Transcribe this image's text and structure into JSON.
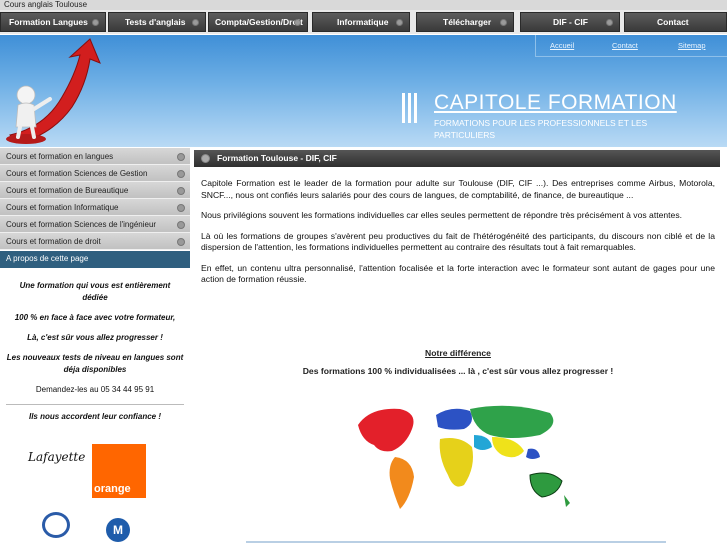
{
  "topbar": {
    "text": "Cours anglais Toulouse"
  },
  "nav": [
    {
      "label": "Formation Langues"
    },
    {
      "label": "Tests d'anglais"
    },
    {
      "label": "Compta/Gestion/Droit"
    },
    {
      "label": "Informatique"
    },
    {
      "label": "Télécharger"
    },
    {
      "label": "DIF - CIF"
    },
    {
      "label": "Contact"
    }
  ],
  "header": {
    "links": [
      "Accueil",
      "Contact",
      "Sitemap"
    ],
    "title": "CAPITOLE FORMATION",
    "subtitle": "FORMATIONS POUR LES PROFESSIONNELS ET LES PARTICULIERS"
  },
  "sidebar": {
    "items": [
      "Cours et formation en langues",
      "Cours et formation Sciences de Gestion",
      "Cours et formation de Bureautique",
      "Cours et formation Informatique",
      "Cours et formation Sciences de l'ingénieur",
      "Cours et formation de droit"
    ],
    "apropos": "A propos de cette page",
    "promo": {
      "line1": "Une formation qui vous est entièrement dédiée",
      "line2": "100 % en face à face avec votre formateur,",
      "line3": "Là, c'est sûr vous allez progresser !",
      "line4": "Les nouveaux tests  de niveau en langues sont déja disponibles",
      "line5": "Demandez-les au 05 34 44 95 91"
    },
    "confiance": "Ils nous accordent leur confiance !",
    "logos": {
      "lafayette": "Lafayette",
      "orange": "orange",
      "motorola": "M"
    }
  },
  "content": {
    "heading": "Formation Toulouse - DIF, CIF",
    "p1": "Capitole Formation est le leader de la formation pour adulte sur Toulouse (DIF, CIF ...). Des entreprises comme Airbus, Motorola, SNCF..., nous ont confiés leurs salariés pour des cours de langues, de comptabilité, de finance, de bureautique ...",
    "p2": "Nous privilégions souvent les formations individuelles car elles seules permettent de répondre très précisément à vos attentes.",
    "p3": "Là où les formations de groupes s'avèrent peu productives du fait de l'hétérogénéité des participants, du discours non ciblé et de la dispersion de l'attention, les formations individuelles permettent au contraire des résultats tout à fait remarquables.",
    "p4": "En effet, un contenu ultra personnalisé, l'attention focalisée et la forte interaction avec le formateur sont autant de gages pour une action de formation réussie.",
    "diff_title": "Notre différence",
    "diff_sub": "Des formations 100 % individualisées ... là , c'est sûr vous allez progresser !"
  },
  "colors": {
    "nav": "#3a3a3a",
    "header_top": "#3f8fd7",
    "apropos": "#2f5f7f",
    "orange": "#ff6600"
  }
}
